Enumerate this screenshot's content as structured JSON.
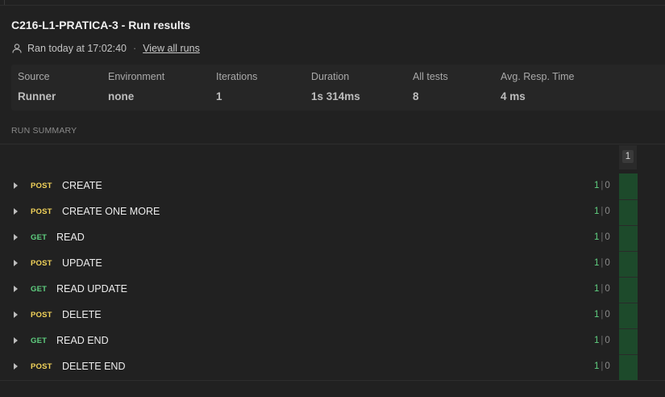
{
  "title": "C216-L1-PRATICA-3 - Run results",
  "meta": {
    "ran_text": "Ran today at 17:02:40",
    "separator": "·",
    "view_all_runs": "View all runs"
  },
  "stats": [
    {
      "label": "Source",
      "value": "Runner"
    },
    {
      "label": "Environment",
      "value": "none"
    },
    {
      "label": "Iterations",
      "value": "1"
    },
    {
      "label": "Duration",
      "value": "1s 314ms"
    },
    {
      "label": "All tests",
      "value": "8"
    },
    {
      "label": "Avg. Resp. Time",
      "value": "4 ms"
    }
  ],
  "section_label": "RUN SUMMARY",
  "iteration_header": "1",
  "requests": [
    {
      "method": "POST",
      "name": "CREATE",
      "passed": "1",
      "failed": "0"
    },
    {
      "method": "POST",
      "name": "CREATE ONE MORE",
      "passed": "1",
      "failed": "0"
    },
    {
      "method": "GET",
      "name": "READ",
      "passed": "1",
      "failed": "0"
    },
    {
      "method": "POST",
      "name": "UPDATE",
      "passed": "1",
      "failed": "0"
    },
    {
      "method": "GET",
      "name": "READ UPDATE",
      "passed": "1",
      "failed": "0"
    },
    {
      "method": "POST",
      "name": "DELETE",
      "passed": "1",
      "failed": "0"
    },
    {
      "method": "GET",
      "name": "READ END",
      "passed": "1",
      "failed": "0"
    },
    {
      "method": "POST",
      "name": "DELETE END",
      "passed": "1",
      "failed": "0"
    }
  ],
  "colors": {
    "background": "#212121",
    "post": "#f2d35a",
    "get": "#5fcf80",
    "pass_cell": "#1d4a2b"
  }
}
